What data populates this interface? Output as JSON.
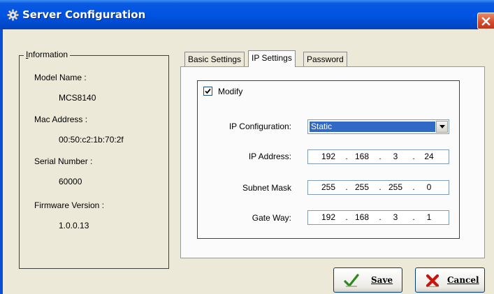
{
  "window": {
    "title": "Server Configuration",
    "icon": "gear-icon",
    "close_icon": "close-icon"
  },
  "information": {
    "legend": "Information",
    "fields": [
      {
        "label": "Model Name :",
        "value": "MCS8140"
      },
      {
        "label": "Mac Address :",
        "value": "00:50:c2:1b:70:2f"
      },
      {
        "label": "Serial Number :",
        "value": "60000"
      },
      {
        "label": "Firmware Version :",
        "value": "1.0.0.13"
      }
    ]
  },
  "tabs": [
    {
      "label": "Basic Settings",
      "active": false
    },
    {
      "label": "IP Settings",
      "active": true
    },
    {
      "label": "Password",
      "active": false
    }
  ],
  "ip_settings": {
    "modify_label": "Modify",
    "modify_checked": true,
    "ip_config_label": "IP Configuration:",
    "ip_config_value": "Static",
    "ip_address_label": "IP Address:",
    "ip_address": [
      "192",
      "168",
      "3",
      "24"
    ],
    "subnet_label": "Subnet Mask",
    "subnet": [
      "255",
      "255",
      "255",
      "0"
    ],
    "gateway_label": "Gate Way:",
    "gateway": [
      "192",
      "168",
      "3",
      "1"
    ],
    "separator": "."
  },
  "buttons": {
    "save_label": "Save",
    "cancel_label": "Cancel"
  },
  "colors": {
    "titlebar": "#0054e3",
    "selection": "#316ac5",
    "close_button": "#d3492c"
  }
}
